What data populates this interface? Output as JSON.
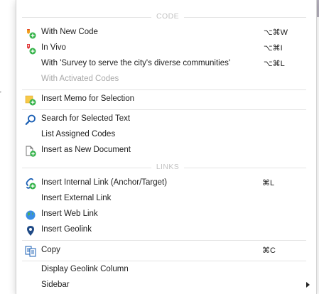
{
  "background": {
    "edge_char": "r"
  },
  "menu": {
    "code_section": "CODE",
    "with_new_code": "With New Code",
    "with_new_code_shortcut": "⌥⌘W",
    "in_vivo": "In Vivo",
    "in_vivo_shortcut": "⌥⌘I",
    "with_code": "With 'Survey to serve the city's diverse communities'",
    "with_code_shortcut": "⌥⌘L",
    "with_activated": "With Activated Codes",
    "insert_memo": "Insert Memo for Selection",
    "search_text": "Search for Selected Text",
    "list_codes": "List Assigned Codes",
    "insert_document": "Insert as New Document",
    "links_section": "LINKS",
    "internal_link": "Insert Internal Link (Anchor/Target)",
    "internal_link_shortcut": "⌘L",
    "external_link": "Insert External Link",
    "web_link": "Insert Web Link",
    "geolink": "Insert Geolink",
    "copy": "Copy",
    "copy_shortcut": "⌘C",
    "display_geolink": "Display Geolink Column",
    "sidebar": "Sidebar"
  },
  "colors": {
    "code_orange": "#f0a020",
    "code_red": "#e0393a",
    "add_green": "#35b34a",
    "memo_yellow": "#f7c948",
    "search_blue": "#1a5fb4",
    "globe_blue": "#3a8ee6",
    "pin_navy": "#1f4a86"
  }
}
